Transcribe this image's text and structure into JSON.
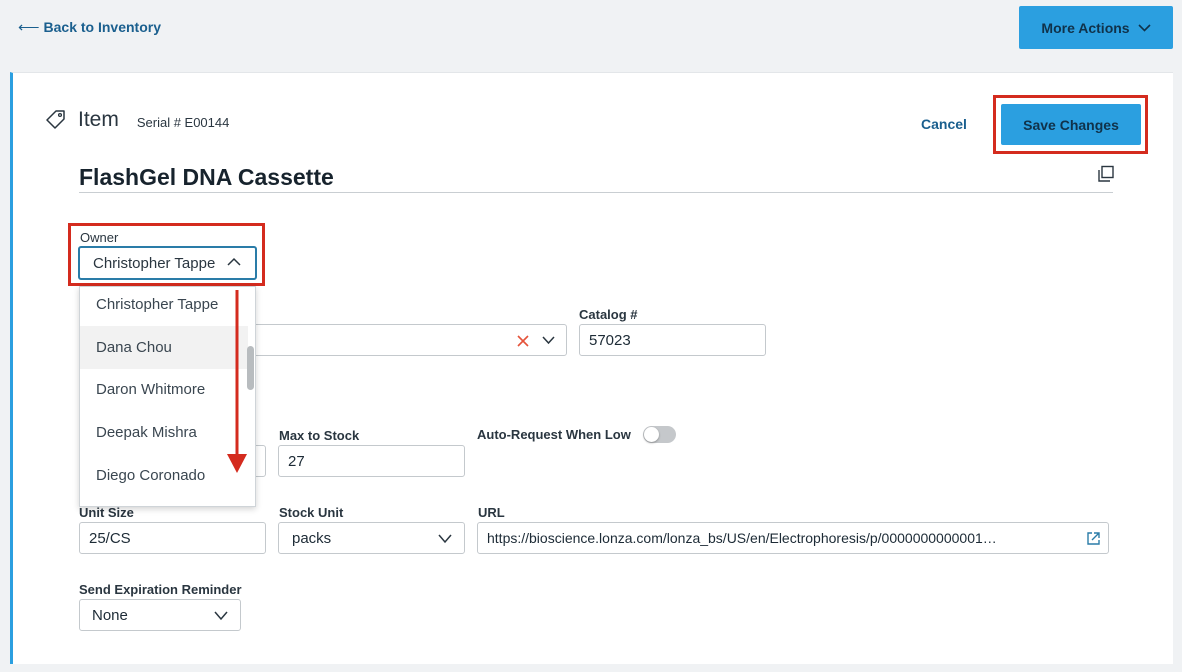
{
  "nav": {
    "back_label": "Back to Inventory"
  },
  "header": {
    "more_actions_label": "More Actions"
  },
  "item": {
    "type_label": "Item",
    "serial": "Serial # E00144",
    "name": "FlashGel DNA Cassette",
    "cancel_label": "Cancel",
    "save_label": "Save Changes"
  },
  "owner": {
    "label": "Owner",
    "selected": "Christopher Tappe",
    "options": [
      "Christopher Tappe",
      "Dana Chou",
      "Daron Whitmore",
      "Deepak Mishra",
      "Diego Coronado"
    ],
    "hovered_option": "Dana Chou"
  },
  "fields": {
    "catalog_label": "Catalog #",
    "catalog_value": "57023",
    "max_stock_label": "Max to Stock",
    "max_stock_value": "27",
    "auto_request_label": "Auto-Request When Low",
    "auto_request_on": false,
    "unit_size_label": "Unit Size",
    "unit_size_value": "25/CS",
    "stock_unit_label": "Stock Unit",
    "stock_unit_value": "packs",
    "url_label": "URL",
    "url_value": "https://bioscience.lonza.com/lonza_bs/US/en/Electrophoresis/p/0000000000001…",
    "expiration_label": "Send Expiration Reminder",
    "expiration_value": "None"
  },
  "colors": {
    "primary": "#2b9fe0",
    "link": "#1a5f8e",
    "highlight": "#d42b1e",
    "clear_x": "#e5533a"
  }
}
